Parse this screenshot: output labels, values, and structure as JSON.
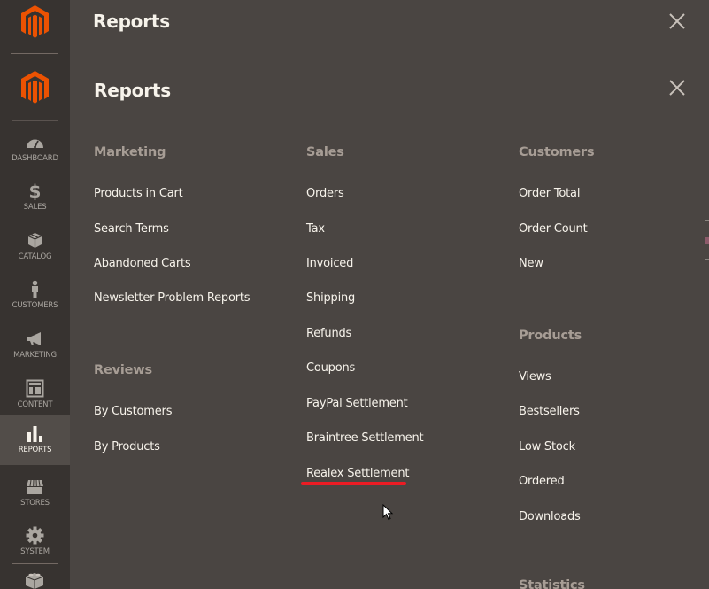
{
  "top_band": {
    "title": "Reports",
    "close_icon": "close-icon"
  },
  "sidebar": {
    "logo": "magento-logo",
    "items": [
      {
        "label": "DASHBOARD",
        "icon": "dashboard-icon",
        "active": false
      },
      {
        "label": "SALES",
        "icon": "dollar-icon",
        "active": false
      },
      {
        "label": "CATALOG",
        "icon": "box-icon",
        "active": false
      },
      {
        "label": "CUSTOMERS",
        "icon": "person-icon",
        "active": false
      },
      {
        "label": "MARKETING",
        "icon": "megaphone-icon",
        "active": false
      },
      {
        "label": "CONTENT",
        "icon": "layout-icon",
        "active": false
      },
      {
        "label": "REPORTS",
        "icon": "bar-chart-icon",
        "active": true
      },
      {
        "label": "STORES",
        "icon": "storefront-icon",
        "active": false
      },
      {
        "label": "SYSTEM",
        "icon": "gear-icon",
        "active": false
      }
    ],
    "extension_icon": "lego-brick-icon"
  },
  "panel": {
    "title": "Reports",
    "close_icon": "close-icon",
    "columns": [
      {
        "groups": [
          {
            "title": "Marketing",
            "links": [
              "Products in Cart",
              "Search Terms",
              "Abandoned Carts",
              "Newsletter Problem Reports"
            ]
          },
          {
            "title": "Reviews",
            "links": [
              "By Customers",
              "By Products"
            ]
          }
        ]
      },
      {
        "groups": [
          {
            "title": "Sales",
            "links": [
              "Orders",
              "Tax",
              "Invoiced",
              "Shipping",
              "Refunds",
              "Coupons",
              "PayPal Settlement",
              "Braintree Settlement",
              "Realex Settlement"
            ]
          }
        ]
      },
      {
        "groups": [
          {
            "title": "Customers",
            "links": [
              "Order Total",
              "Order Count",
              "New"
            ]
          },
          {
            "title": "Products",
            "links": [
              "Views",
              "Bestsellers",
              "Low Stock",
              "Ordered",
              "Downloads"
            ]
          },
          {
            "title": "Statistics",
            "links": []
          }
        ]
      }
    ],
    "highlighted_link": "Realex Settlement"
  },
  "colors": {
    "accent_orange": "#eb5202",
    "highlight_red": "#eb1c24",
    "panel_bg": "#4a4542",
    "sidebar_bg": "#373330",
    "group_title": "#a79d95",
    "link_text": "#f7f3eb"
  }
}
